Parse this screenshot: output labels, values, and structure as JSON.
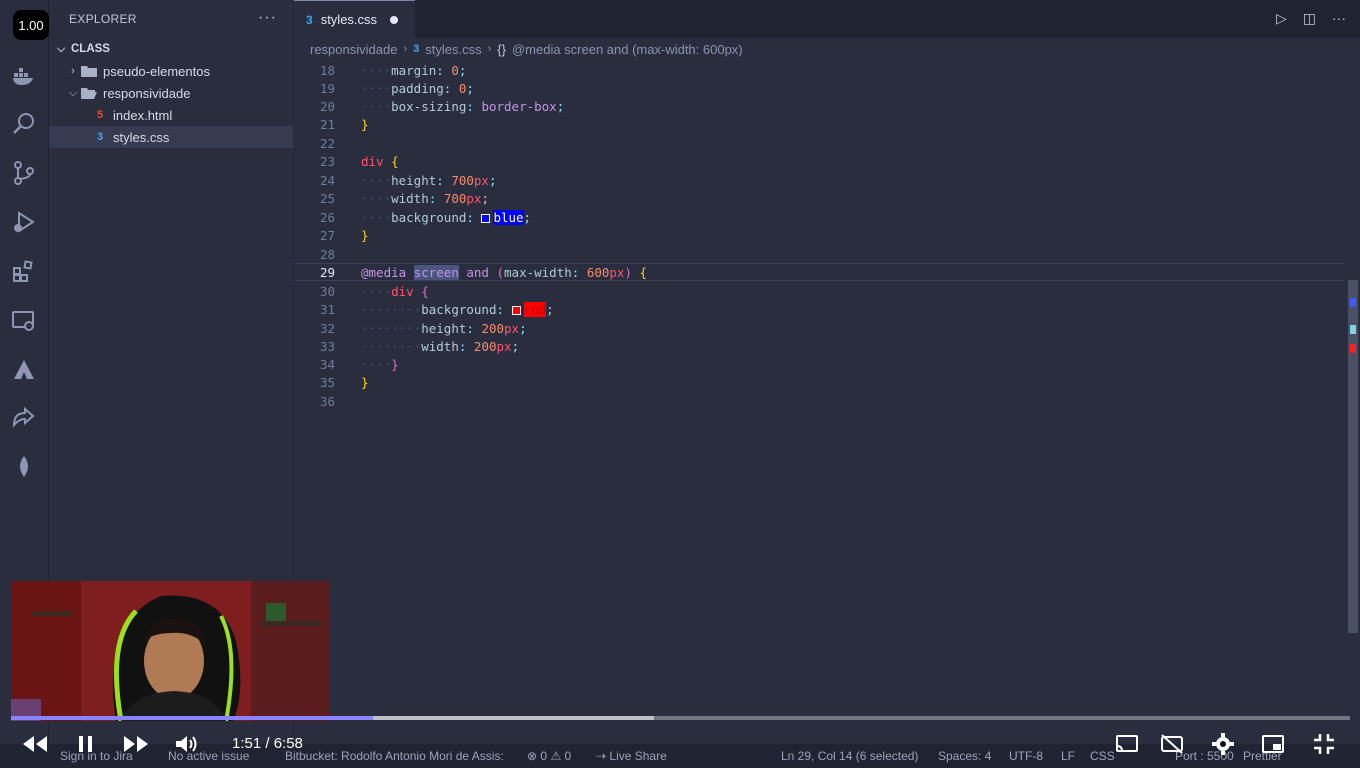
{
  "playback_speed": "1.00",
  "explorer": {
    "title": "EXPLORER",
    "more": "···",
    "root": "CLASS",
    "items": [
      {
        "label": "pseudo-elementos",
        "type": "folder",
        "expanded": false
      },
      {
        "label": "responsividade",
        "type": "folder",
        "expanded": true
      },
      {
        "label": "index.html",
        "type": "html"
      },
      {
        "label": "styles.css",
        "type": "css",
        "selected": true
      }
    ]
  },
  "tab": {
    "label": "styles.css",
    "dirty": true
  },
  "breadcrumb": {
    "folder": "responsividade",
    "file": "styles.css",
    "symbol": "@media screen and (max-width: 600px)"
  },
  "code": {
    "active_line": 29,
    "lines": [
      {
        "n": "18",
        "text": "margin: 0;"
      },
      {
        "n": "19",
        "text": "padding: 0;"
      },
      {
        "n": "20",
        "text": "box-sizing: border-box;"
      },
      {
        "n": "21",
        "text": "}"
      },
      {
        "n": "22",
        "text": ""
      },
      {
        "n": "23",
        "text": "div {"
      },
      {
        "n": "24",
        "text": "height: 700px;"
      },
      {
        "n": "25",
        "text": "width: 700px;"
      },
      {
        "n": "26",
        "text": "background: blue;"
      },
      {
        "n": "27",
        "text": "}"
      },
      {
        "n": "28",
        "text": ""
      },
      {
        "n": "29",
        "text": "@media screen and (max-width: 600px) {"
      },
      {
        "n": "30",
        "text": "div {"
      },
      {
        "n": "31",
        "text": "background: red;"
      },
      {
        "n": "32",
        "text": "height: 200px;"
      },
      {
        "n": "33",
        "text": "width: 200px;"
      },
      {
        "n": "34",
        "text": "}"
      },
      {
        "n": "35",
        "text": "}"
      },
      {
        "n": "36",
        "text": ""
      }
    ]
  },
  "status": {
    "sign_in": "Sign in to Jira",
    "issue": "No active issue",
    "bitbucket": "Bitbucket: Rodolfo Antonio Mori de Assis:",
    "errors": "0",
    "warnings": "0",
    "live_share": "Live Share",
    "position": "Ln 29, Col 14 (6 selected)",
    "spaces": "Spaces: 4",
    "encoding": "UTF-8",
    "eol": "LF",
    "language": "CSS",
    "port": "Port : 5500",
    "prettier": "Prettier"
  },
  "video": {
    "current_time": "1:51",
    "duration": "6:58",
    "time_display": "1:51 / 6:58",
    "progress_played": 0.27,
    "progress_loaded": 0.48
  },
  "colors": {
    "accent_progress": "#8b82ff",
    "swatch_blue": "#0000ff",
    "swatch_red": "#ff0000",
    "css_icon": "#42a5f5",
    "html_icon": "#e44d26"
  }
}
